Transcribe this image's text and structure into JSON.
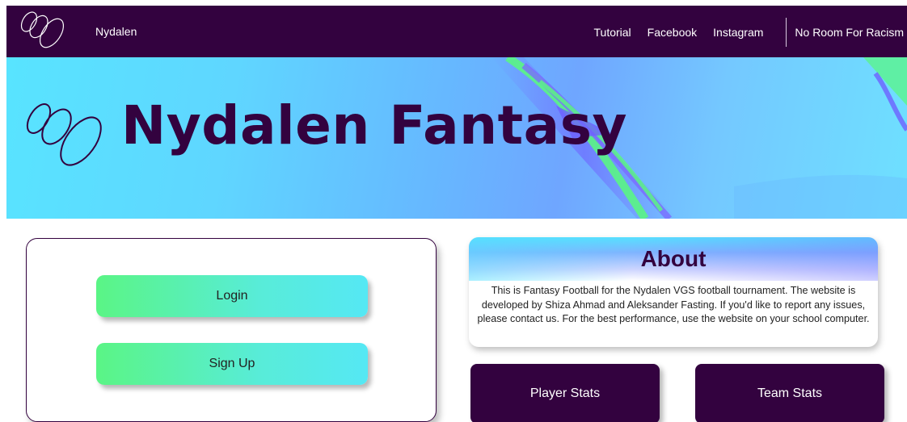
{
  "nav": {
    "brand": "Nydalen",
    "links": [
      "Tutorial",
      "Facebook",
      "Instagram"
    ],
    "highlight_link": "No Room For Racism",
    "logo_icon": "rings-logo-icon"
  },
  "hero": {
    "title": "Nydalen Fantasy",
    "logo_icon": "rings-logo-icon"
  },
  "auth": {
    "login_label": "Login",
    "signup_label": "Sign Up"
  },
  "about": {
    "title": "About",
    "text": "This is Fantasy Football for the Nydalen VGS football tournament. The website is developed by Shiza Ahmad and Aleksander Fasting. If you'd like to report any issues, please contact us. For the best performance, use the website on your school computer."
  },
  "stats": {
    "player_label": "Player Stats",
    "team_label": "Team Stats"
  },
  "colors": {
    "primary": "#33023f",
    "hero_cyan": "#58e4ff",
    "hero_green": "#5af585",
    "button_gradient_start": "#5af585",
    "button_gradient_end": "#55e8f4"
  }
}
